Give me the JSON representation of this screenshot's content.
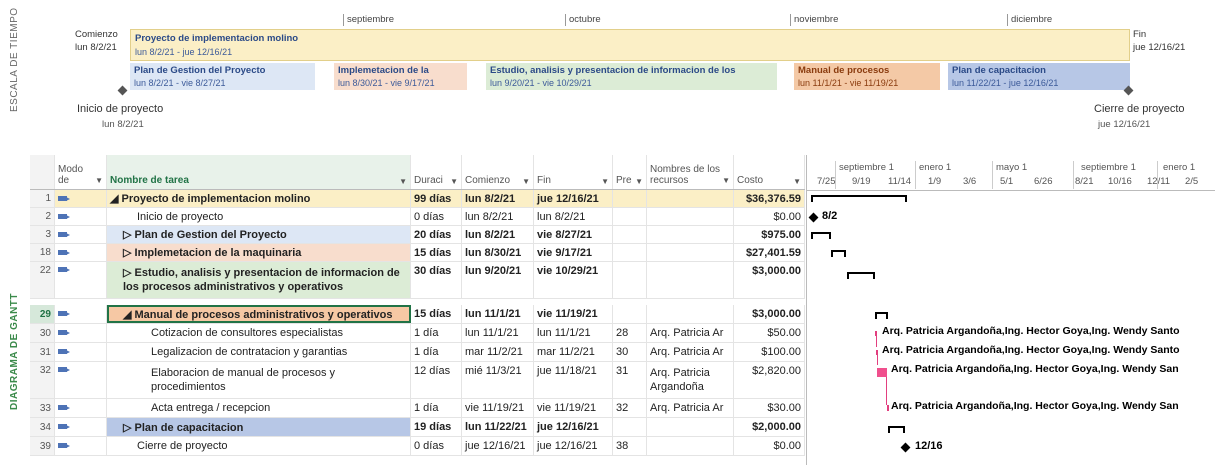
{
  "labels": {
    "timeline_axis": "ESCALA DE TIEMPO",
    "gantt_axis": "DIAGRAMA DE GANTT"
  },
  "timeline": {
    "months": [
      "septiembre",
      "octubre",
      "noviembre",
      "diciembre"
    ],
    "start_label": "Comienzo",
    "start_date": "lun 8/2/21",
    "end_label": "Fin",
    "end_date": "jue 12/16/21",
    "main": {
      "title": "Proyecto de implementacion molino",
      "dates": "lun 8/2/21 - jue 12/16/21"
    },
    "phases": [
      {
        "title": "Plan de Gestion del Proyecto",
        "dates": "lun 8/2/21 - vie 8/27/21",
        "color": "#dde7f5"
      },
      {
        "title": "Implemetacion de la",
        "dates": "lun 8/30/21 - vie 9/17/21",
        "color": "#f8ddcd"
      },
      {
        "title": "Estudio, analisis y presentacion de informacion de los",
        "dates": "lun 9/20/21 - vie 10/29/21",
        "color": "#dcecd6"
      },
      {
        "title": "Manual de procesos",
        "dates": "lun 11/1/21 - vie 11/19/21",
        "color": "#f4c9a6"
      },
      {
        "title": "Plan de capacitacion",
        "dates": "lun 11/22/21 - jue 12/16/21",
        "color": "#b7c7e6"
      }
    ],
    "milestone_start": {
      "label": "Inicio de proyecto",
      "date": "lun 8/2/21"
    },
    "milestone_end": {
      "label": "Cierre de proyecto",
      "date": "jue 12/16/21"
    }
  },
  "grid": {
    "headers": {
      "mode": "Modo de",
      "name": "Nombre de tarea",
      "duration": "Duraci",
      "start": "Comienzo",
      "finish": "Fin",
      "pred": "Pre",
      "resources": "Nombres de los recursos",
      "cost": "Costo"
    },
    "rows": [
      {
        "id": "1",
        "name": "◢ Proyecto de implementacion molino",
        "duration": "99 días",
        "start": "lun 8/2/21",
        "finish": "jue 12/16/21",
        "pred": "",
        "resources": "",
        "cost": "$36,376.59"
      },
      {
        "id": "2",
        "name": "Inicio de proyecto",
        "duration": "0 días",
        "start": "lun 8/2/21",
        "finish": "lun 8/2/21",
        "pred": "",
        "resources": "",
        "cost": "$0.00"
      },
      {
        "id": "3",
        "name": "▷ Plan de Gestion del Proyecto",
        "duration": "20 días",
        "start": "lun 8/2/21",
        "finish": "vie 8/27/21",
        "pred": "",
        "resources": "",
        "cost": "$975.00"
      },
      {
        "id": "18",
        "name": "▷ Implemetacion de la maquinaria",
        "duration": "15 días",
        "start": "lun 8/30/21",
        "finish": "vie 9/17/21",
        "pred": "",
        "resources": "",
        "cost": "$27,401.59"
      },
      {
        "id": "22",
        "name": "▷ Estudio, analisis y presentacion de informacion de los procesos administrativos y operativos",
        "duration": "30 días",
        "start": "lun 9/20/21",
        "finish": "vie 10/29/21",
        "pred": "",
        "resources": "",
        "cost": "$3,000.00"
      },
      {
        "id": "29",
        "name": "◢ Manual de procesos administrativos y operativos",
        "duration": "15 días",
        "start": "lun 11/1/21",
        "finish": "vie 11/19/21",
        "pred": "",
        "resources": "",
        "cost": "$3,000.00"
      },
      {
        "id": "30",
        "name": "Cotizacion de consultores especialistas",
        "duration": "1 día",
        "start": "lun 11/1/21",
        "finish": "lun 11/1/21",
        "pred": "28",
        "resources": "Arq. Patricia Ar",
        "cost": "$50.00"
      },
      {
        "id": "31",
        "name": "Legalizacion de contratacion y garantias",
        "duration": "1 día",
        "start": "mar 11/2/21",
        "finish": "mar 11/2/21",
        "pred": "30",
        "resources": "Arq. Patricia Ar",
        "cost": "$100.00"
      },
      {
        "id": "32",
        "name": "Elaboracion de manual de procesos y procedimientos",
        "duration": "12 días",
        "start": "mié 11/3/21",
        "finish": "jue 11/18/21",
        "pred": "31",
        "resources": "Arq. Patricia Argandoña",
        "cost": "$2,820.00"
      },
      {
        "id": "33",
        "name": "Acta entrega / recepcion",
        "duration": "1 día",
        "start": "vie 11/19/21",
        "finish": "vie 11/19/21",
        "pred": "32",
        "resources": "Arq. Patricia Ar",
        "cost": "$30.00"
      },
      {
        "id": "34",
        "name": "▷ Plan de capacitacion",
        "duration": "19 días",
        "start": "lun 11/22/21",
        "finish": "jue 12/16/21",
        "pred": "",
        "resources": "",
        "cost": "$2,000.00"
      },
      {
        "id": "39",
        "name": "Cierre de proyecto",
        "duration": "0 días",
        "start": "jue 12/16/21",
        "finish": "jue 12/16/21",
        "pred": "38",
        "resources": "",
        "cost": "$0.00"
      }
    ]
  },
  "gantt": {
    "top_scale": [
      "septiembre 1",
      "enero 1",
      "mayo 1",
      "septiembre 1",
      "enero 1"
    ],
    "bottom_scale": [
      "7/25",
      "9/19",
      "11/14",
      "1/9",
      "3/6",
      "5/1",
      "6/26",
      "8/21",
      "10/16",
      "12/11",
      "2/5"
    ],
    "milestone_start_label": "8/2",
    "milestone_end_label": "12/16",
    "resource_label_a": "Arq. Patricia Argandoña,Ing. Hector Goya,Ing. Wendy Santo",
    "resource_label_b": "Arq. Patricia Argandoña,Ing. Hector Goya,Ing. Wendy San"
  }
}
